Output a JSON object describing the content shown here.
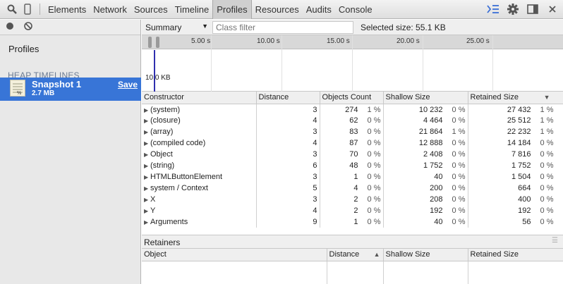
{
  "toolbar": {
    "tabs": [
      "Elements",
      "Network",
      "Sources",
      "Timeline",
      "Profiles",
      "Resources",
      "Audits",
      "Console"
    ],
    "active_tab": "Profiles"
  },
  "sidebar": {
    "title": "Profiles",
    "section": "HEAP TIMELINES",
    "snapshot": {
      "name": "Snapshot 1",
      "size": "2.7 MB",
      "save_label": "Save"
    }
  },
  "main": {
    "view": "Summary",
    "class_filter_placeholder": "Class filter",
    "selected_size": "Selected size: 55.1 KB",
    "timeline": {
      "ticks": [
        "5.00 s",
        "10.00 s",
        "15.00 s",
        "20.00 s",
        "25.00 s"
      ],
      "y_label": "10.0 KB"
    },
    "columns": {
      "constructor": "Constructor",
      "distance": "Distance",
      "objects": "Objects Count",
      "shallow": "Shallow Size",
      "retained": "Retained Size"
    },
    "rows": [
      {
        "name": "(system)",
        "distance": "3",
        "count": "274",
        "count_pct": "1 %",
        "shallow": "10 232",
        "shallow_pct": "0 %",
        "retained": "27 432",
        "retained_pct": "1 %"
      },
      {
        "name": "(closure)",
        "distance": "4",
        "count": "62",
        "count_pct": "0 %",
        "shallow": "4 464",
        "shallow_pct": "0 %",
        "retained": "25 512",
        "retained_pct": "1 %"
      },
      {
        "name": "(array)",
        "distance": "3",
        "count": "83",
        "count_pct": "0 %",
        "shallow": "21 864",
        "shallow_pct": "1 %",
        "retained": "22 232",
        "retained_pct": "1 %"
      },
      {
        "name": "(compiled code)",
        "distance": "4",
        "count": "87",
        "count_pct": "0 %",
        "shallow": "12 888",
        "shallow_pct": "0 %",
        "retained": "14 184",
        "retained_pct": "0 %"
      },
      {
        "name": "Object",
        "distance": "3",
        "count": "70",
        "count_pct": "0 %",
        "shallow": "2 408",
        "shallow_pct": "0 %",
        "retained": "7 816",
        "retained_pct": "0 %"
      },
      {
        "name": "(string)",
        "distance": "6",
        "count": "48",
        "count_pct": "0 %",
        "shallow": "1 752",
        "shallow_pct": "0 %",
        "retained": "1 752",
        "retained_pct": "0 %"
      },
      {
        "name": "HTMLButtonElement",
        "distance": "3",
        "count": "1",
        "count_pct": "0 %",
        "shallow": "40",
        "shallow_pct": "0 %",
        "retained": "1 504",
        "retained_pct": "0 %"
      },
      {
        "name": "system / Context",
        "distance": "5",
        "count": "4",
        "count_pct": "0 %",
        "shallow": "200",
        "shallow_pct": "0 %",
        "retained": "664",
        "retained_pct": "0 %"
      },
      {
        "name": "X",
        "distance": "3",
        "count": "2",
        "count_pct": "0 %",
        "shallow": "208",
        "shallow_pct": "0 %",
        "retained": "400",
        "retained_pct": "0 %"
      },
      {
        "name": "Y",
        "distance": "4",
        "count": "2",
        "count_pct": "0 %",
        "shallow": "192",
        "shallow_pct": "0 %",
        "retained": "192",
        "retained_pct": "0 %"
      },
      {
        "name": "Arguments",
        "distance": "9",
        "count": "1",
        "count_pct": "0 %",
        "shallow": "40",
        "shallow_pct": "0 %",
        "retained": "56",
        "retained_pct": "0 %"
      }
    ],
    "retainers": {
      "title": "Retainers",
      "columns": {
        "object": "Object",
        "distance": "Distance",
        "shallow": "Shallow Size",
        "retained": "Retained Size"
      }
    }
  }
}
